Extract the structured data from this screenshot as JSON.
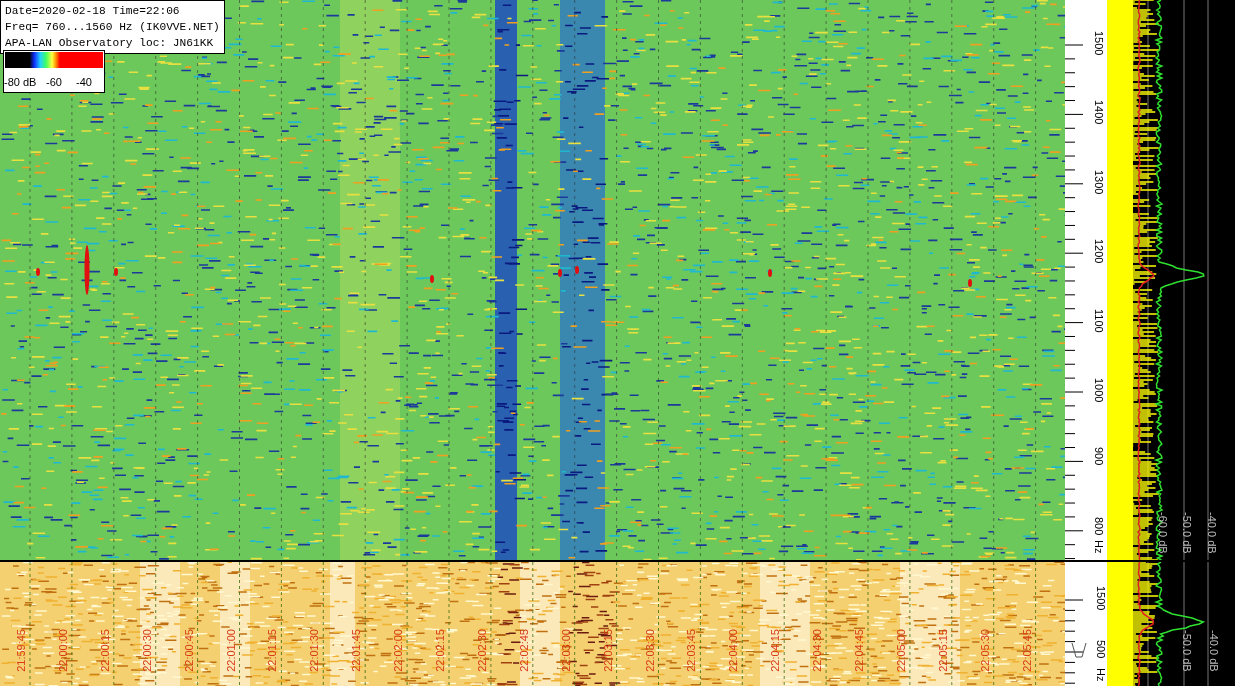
{
  "info": {
    "lines": [
      "Date=2020-02-18 Time=22:06",
      "Freq= 760...1560 Hz (IK0VVE.NET)",
      "APA-LAN Observatory loc: JN61KK"
    ]
  },
  "color_scale": {
    "labels": [
      "-80 dB",
      "-60",
      "-40"
    ]
  },
  "waterfall": {
    "freq_labels": [
      "1500",
      "1400",
      "1300",
      "1200",
      "1100",
      "1000",
      "900",
      "800"
    ],
    "unit": "Hz"
  },
  "spectrum": {
    "db_labels": [
      "-60.0 dB",
      "-50.0 dB",
      "-40.0 dB"
    ]
  },
  "overview": {
    "time_labels": [
      "21:59:45",
      "22:00:00",
      "22:00:15",
      "22:00:30",
      "22:00:45",
      "22:01:00",
      "22:01:15",
      "22:01:30",
      "22:01:45",
      "22:02:00",
      "22:02:15",
      "22:02:30",
      "22:02:45",
      "22:03:00",
      "22:03:15",
      "22:03:30",
      "22:03:45",
      "22:04:00",
      "22:04:15",
      "22:04:30",
      "22:04:45",
      "22:05:00",
      "22:05:15",
      "22:05:30",
      "22:05:45"
    ],
    "freq_labels": [
      "1500",
      "500"
    ],
    "unit": "Hz"
  },
  "overview_spectrum": {
    "db_labels": [
      "-50.0 dB",
      "-40.0 dB"
    ]
  }
}
